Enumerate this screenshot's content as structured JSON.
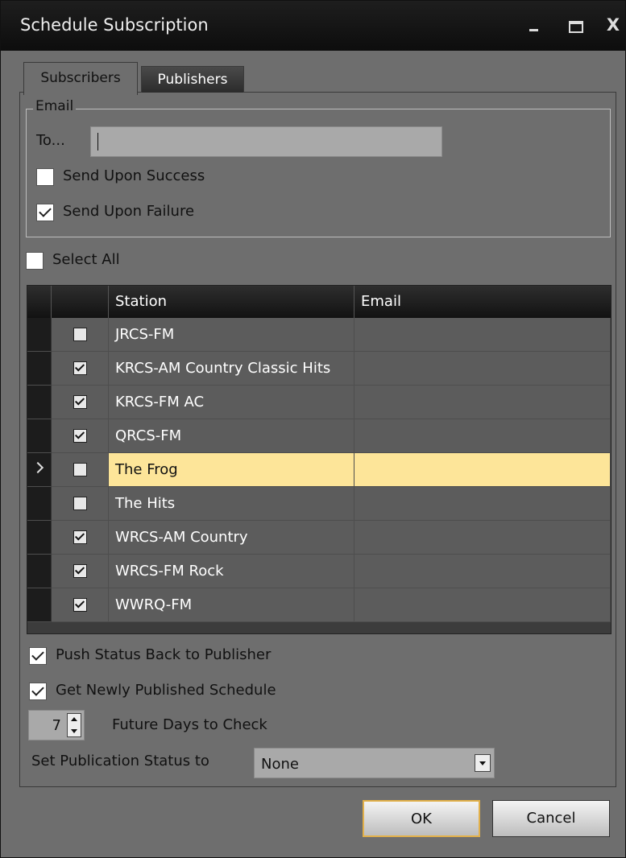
{
  "window": {
    "title": "Schedule Subscription",
    "min_icon": "minimize-icon",
    "max_icon": "maximize-icon",
    "close_glyph": "X"
  },
  "tabs": [
    {
      "label": "Subscribers",
      "active": true
    },
    {
      "label": "Publishers",
      "active": false
    }
  ],
  "email_group": {
    "legend": "Email",
    "to_label": "To...",
    "to_value": "",
    "send_upon_success": {
      "label": "Send Upon Success",
      "checked": false
    },
    "send_upon_failure": {
      "label": "Send Upon Failure",
      "checked": true
    }
  },
  "select_all": {
    "label": "Select All",
    "checked": false
  },
  "grid": {
    "columns": [
      "Station",
      "Email"
    ],
    "rows": [
      {
        "station": "JRCS-FM",
        "checked": false,
        "email": ""
      },
      {
        "station": "KRCS-AM Country Classic Hits",
        "checked": true,
        "email": ""
      },
      {
        "station": "KRCS-FM AC",
        "checked": true,
        "email": ""
      },
      {
        "station": "QRCS-FM",
        "checked": true,
        "email": ""
      },
      {
        "station": "The Frog",
        "checked": false,
        "email": "",
        "selected": true
      },
      {
        "station": "The Hits",
        "checked": false,
        "email": ""
      },
      {
        "station": "WRCS-AM Country",
        "checked": true,
        "email": ""
      },
      {
        "station": "WRCS-FM Rock",
        "checked": true,
        "email": ""
      },
      {
        "station": "WWRQ-FM",
        "checked": true,
        "email": ""
      }
    ]
  },
  "push_status": {
    "label": "Push Status Back to Publisher",
    "checked": true
  },
  "get_newly": {
    "label": "Get Newly Published Schedule",
    "checked": true
  },
  "future_days": {
    "value": "7",
    "label": "Future Days to Check"
  },
  "publication_status": {
    "label": "Set Publication Status to",
    "value": "None"
  },
  "buttons": {
    "ok": "OK",
    "cancel": "Cancel"
  }
}
